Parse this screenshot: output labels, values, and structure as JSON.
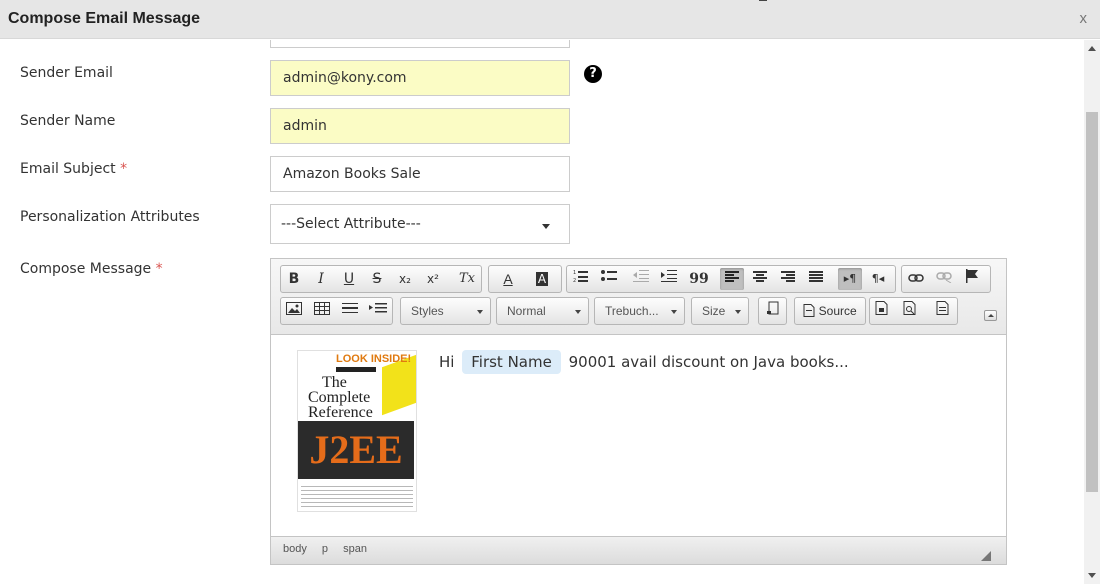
{
  "dialog": {
    "title": "Compose Email Message",
    "close_label": "x"
  },
  "form": {
    "sender_email": {
      "label": "Sender Email",
      "value": "admin@kony.com",
      "help": "?"
    },
    "sender_name": {
      "label": "Sender Name",
      "value": "admin"
    },
    "email_subject": {
      "label": "Email Subject",
      "required": "*",
      "value": "Amazon Books Sale"
    },
    "personalization": {
      "label": "Personalization Attributes",
      "selected": "---Select Attribute---"
    },
    "compose": {
      "label": "Compose Message",
      "required": "*"
    }
  },
  "editor": {
    "toolbar_row1": {
      "bold": "B",
      "italic": "I",
      "underline": "U",
      "strike": "S",
      "subscript": "x₂",
      "superscript": "x²",
      "remove_format": "Tx",
      "text_color": "A",
      "bg_color": "A",
      "blockquote": "99",
      "rtl": "¶◂",
      "ltr": "▸¶"
    },
    "toolbar_row2": {
      "styles": "Styles",
      "format": "Normal",
      "font": "Trebuch...",
      "size": "Size",
      "source": "Source"
    },
    "content": {
      "greeting": "Hi",
      "placeholder_chip": "First Name",
      "message": "90001 avail discount on Java books...",
      "book": {
        "look_inside": "LOOK INSIDE!",
        "title_line1": "The",
        "title_line2": "Complete",
        "title_line3": "Reference",
        "title_big": "J2EE"
      }
    },
    "path": [
      "body",
      "p",
      "span"
    ]
  },
  "colors": {
    "title_bar": "#e6e6e6",
    "autofill_yellow": "#fbfcc5",
    "chip_blue": "#dcecf9",
    "required_red": "#d9534f"
  }
}
